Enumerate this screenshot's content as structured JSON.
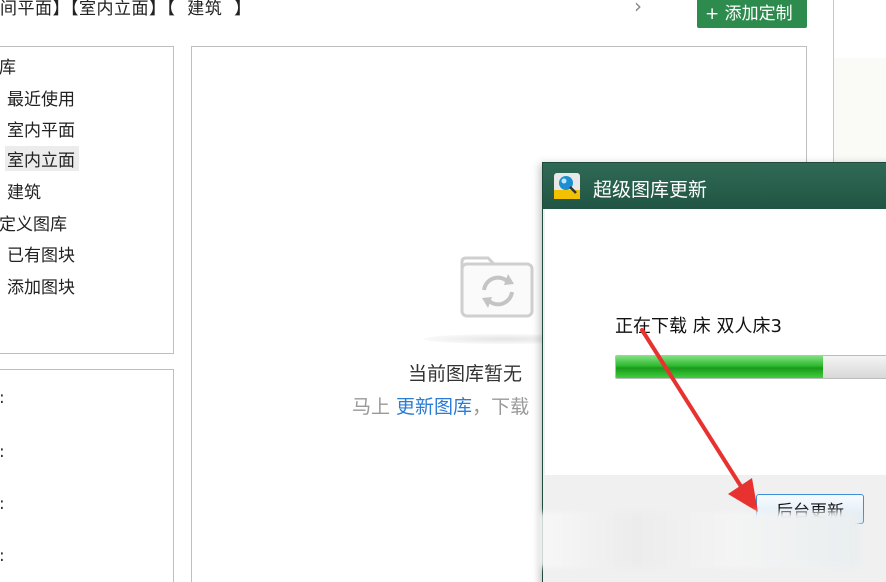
{
  "breadcrumb": "间平面】【室内立面】【  建筑  】",
  "next_arrow": "›",
  "add_button": "+ 添加定制",
  "tree": {
    "items": [
      {
        "label": "库"
      },
      {
        "label": "最近使用"
      },
      {
        "label": "室内平面"
      },
      {
        "label": "室内立面"
      },
      {
        "label": "建筑"
      },
      {
        "label": "定义图库"
      },
      {
        "label": "已有图块"
      },
      {
        "label": "添加图块"
      }
    ]
  },
  "props": {
    "colons": [
      ":",
      ":",
      ":",
      ":"
    ]
  },
  "empty_state": {
    "title": "当前图库暂无",
    "sub_prefix": "马上 ",
    "sub_link": "更新图库",
    "sub_suffix": "，下载"
  },
  "dialog": {
    "title": "超级图库更新",
    "download_text": "正在下载 床 双人床3",
    "progress": 0.72,
    "background_update_button": "后台更新"
  },
  "colors": {
    "accent_green": "#2e8b4e",
    "titlebar": "#215444",
    "link_blue": "#2a7cd6",
    "arrow_red": "#e8322f"
  }
}
